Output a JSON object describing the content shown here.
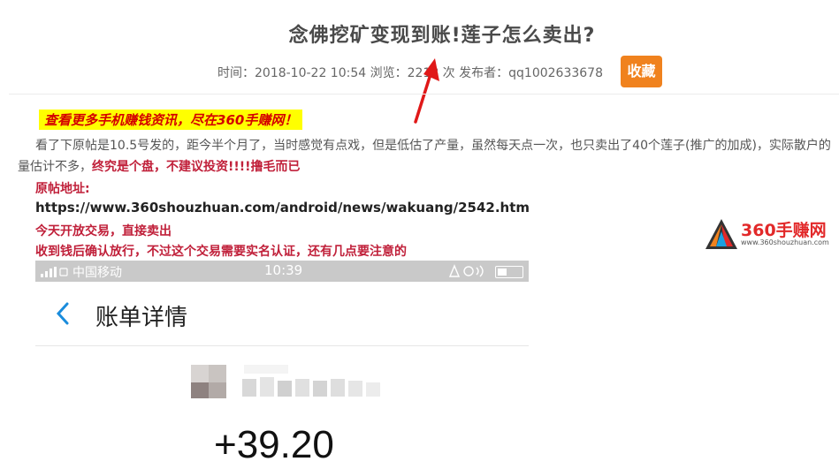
{
  "article": {
    "title": "念佛挖矿变现到账!莲子怎么卖出?",
    "meta_text": "时间：2018-10-22 10:54 浏览：2218 次 发布者：qq1002633678",
    "favorite_label": "收藏"
  },
  "promo": {
    "text": "查看更多手机赚钱资讯，尽在360手赚网！"
  },
  "content": {
    "para_text": "看了下原帖是10.5号发的，距今半个月了，当时感觉有点戏，但是低估了产量，虽然每天点一次，也只卖出了40个莲子(推广的加成)，实际散户的量估计不多，",
    "para_emphasis": "终究是个盘，不建议投资!!!!撸毛而已",
    "source_label": "原帖地址:",
    "source_url": "https://www.360shouzhuan.com/android/news/wakuang/2542.htm",
    "line_trade_today": "今天开放交易，直接卖出",
    "line_notice": "收到钱后确认放行，不过这个交易需要实名认证，还有几点要注意的"
  },
  "logo": {
    "name": "360手赚网",
    "url": "www.360shouzhuan.com"
  },
  "screenshot": {
    "carrier": "中国移动",
    "time": "10:39",
    "page_title": "账单详情",
    "amount": "+39.20"
  },
  "colors": {
    "accent_orange": "#f0821e",
    "emphasis_red": "#c0203a",
    "promo_yellow": "#ffff00",
    "annotation_arrow": "#e01818"
  }
}
